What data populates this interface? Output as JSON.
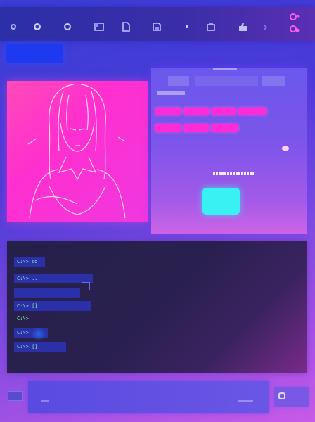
{
  "toolbar": {
    "icons": [
      "circle-icon",
      "record-icon",
      "ring-icon",
      "window-icon",
      "doc-icon",
      "save-icon",
      "small-dot-icon",
      "cart-icon",
      "pointer-icon",
      "chevron-icon",
      "avatar-icon",
      "settings-icon"
    ]
  },
  "image_panel": {
    "subject": "line-drawing of a long-haired figure"
  },
  "dialog": {
    "ok_button_color": "#39f0f2",
    "chip_color": "#ff2bd6"
  },
  "terminal": {
    "lines": [
      {
        "text": "C:\\> cd"
      },
      {
        "text": "C:\\> ..."
      },
      {
        "text": "C:\\> []"
      },
      {
        "text": "C:\\>"
      },
      {
        "text": "C:\\>"
      },
      {
        "text": "C:\\> []"
      }
    ]
  },
  "colors": {
    "accent_blue": "#1d3af0",
    "accent_cyan": "#39f0f2",
    "accent_pink": "#ff2bd6"
  }
}
